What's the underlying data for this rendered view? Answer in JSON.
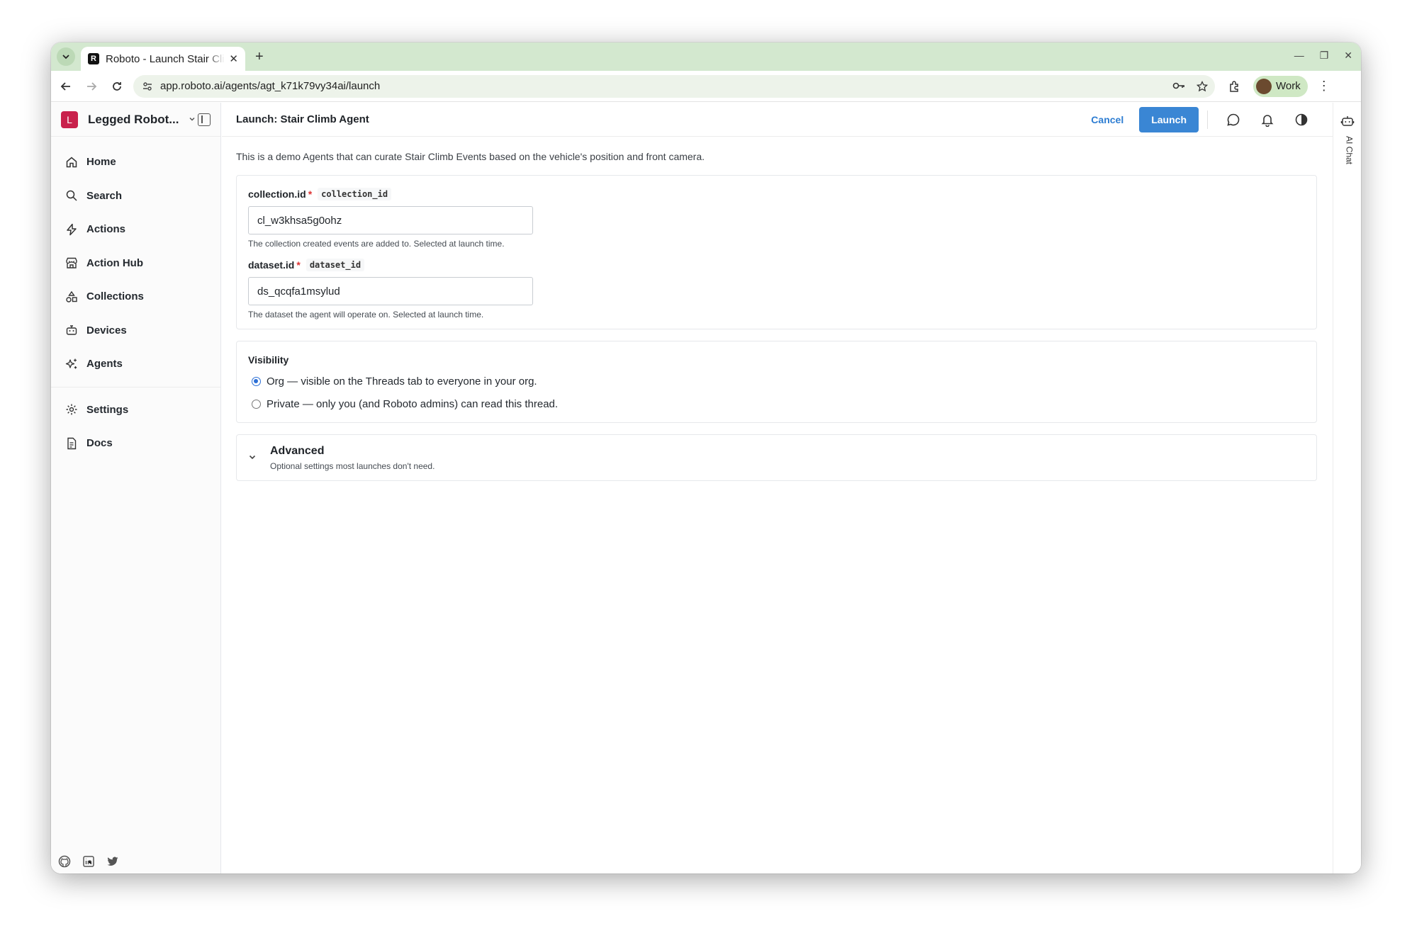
{
  "browser": {
    "tab_title": "Roboto - Launch Stair Climb Agent",
    "tab_favicon": "R",
    "new_tab_label": "+",
    "url": "app.roboto.ai/agents/agt_k71k79vy34ai/launch",
    "profile_label": "Work"
  },
  "sidebar": {
    "org_initial": "L",
    "org_name": "Legged Robot...",
    "items": [
      {
        "label": "Home",
        "icon": "home-icon"
      },
      {
        "label": "Search",
        "icon": "search-icon"
      },
      {
        "label": "Actions",
        "icon": "lightning-icon"
      },
      {
        "label": "Action Hub",
        "icon": "store-icon"
      },
      {
        "label": "Collections",
        "icon": "shapes-icon"
      },
      {
        "label": "Devices",
        "icon": "robot-icon"
      },
      {
        "label": "Agents",
        "icon": "sparkles-icon"
      }
    ],
    "secondary_items": [
      {
        "label": "Settings",
        "icon": "gear-icon"
      },
      {
        "label": "Docs",
        "icon": "document-icon"
      }
    ],
    "social_icons": [
      "github-icon",
      "linkedin-icon",
      "twitter-icon"
    ]
  },
  "topbar": {
    "title": "Launch: Stair Climb Agent",
    "cancel_label": "Cancel",
    "launch_label": "Launch"
  },
  "content": {
    "intro": "This is a demo Agents that can curate Stair Climb Events based on the vehicle's position and front camera.",
    "fields": [
      {
        "label": "collection.id",
        "required_mark": "*",
        "code": "collection_id",
        "value": "cl_w3khsa5g0ohz",
        "help": "The collection created events are added to. Selected at launch time."
      },
      {
        "label": "dataset.id",
        "required_mark": "*",
        "code": "dataset_id",
        "value": "ds_qcqfa1msylud",
        "help": "The dataset the agent will operate on. Selected at launch time."
      }
    ],
    "visibility": {
      "title": "Visibility",
      "options": [
        {
          "label": "Org — visible on the Threads tab to everyone in your org.",
          "checked": true
        },
        {
          "label": "Private — only you (and Roboto admins) can read this thread.",
          "checked": false
        }
      ]
    },
    "advanced": {
      "title": "Advanced",
      "subtitle": "Optional settings most launches don't need."
    }
  },
  "right_rail": {
    "label": "AI Chat"
  },
  "colors": {
    "accent": "#3a86d4",
    "org_avatar": "#c9214c",
    "tabstrip": "#d3e8cf"
  }
}
